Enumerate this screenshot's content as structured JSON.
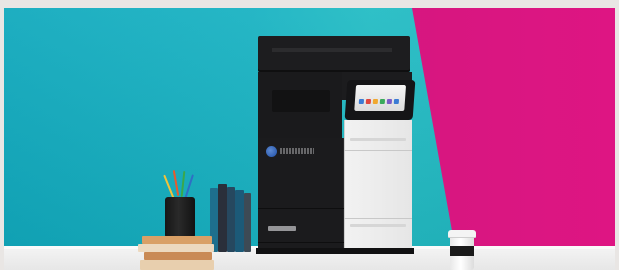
{
  "colors": {
    "frame": "#e9e6e4",
    "teal": "#18b2c2",
    "magenta": "#d5177f",
    "table": "#eeeeee",
    "printer_dark": "#1b1b1d",
    "printer_light": "#eeeeee"
  },
  "scene": {
    "subject": "multifunction-printer",
    "props": [
      "pencil-cup",
      "book-stack",
      "upright-books",
      "coffee-cup"
    ]
  }
}
